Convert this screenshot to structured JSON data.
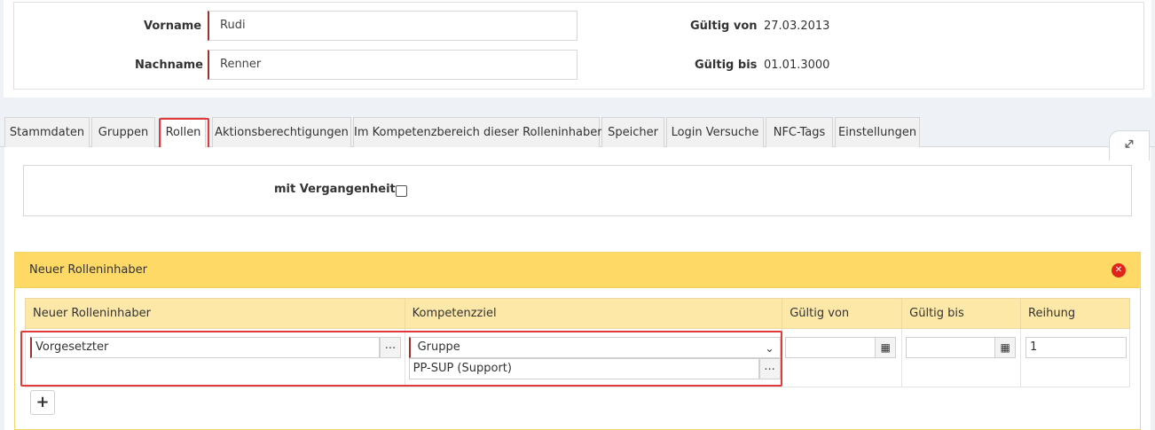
{
  "person": {
    "vorname_label": "Vorname",
    "vorname_value": "Rudi",
    "nachname_label": "Nachname",
    "nachname_value": "Renner",
    "gueltig_von_label": "Gültig von",
    "gueltig_von_value": "27.03.2013",
    "gueltig_bis_label": "Gültig bis",
    "gueltig_bis_value": "01.01.3000"
  },
  "tabs": [
    {
      "label": "Stammdaten"
    },
    {
      "label": "Gruppen"
    },
    {
      "label": "Rollen"
    },
    {
      "label": "Aktionsberechtigungen"
    },
    {
      "label": "Im Kompetenzbereich dieser Rolleninhaber"
    },
    {
      "label": "Speicher"
    },
    {
      "label": "Login Versuche"
    },
    {
      "label": "NFC-Tags"
    },
    {
      "label": "Einstellungen"
    }
  ],
  "active_tab": "Rollen",
  "filter": {
    "mit_vergangenheit_label": "mit Vergangenheit",
    "mit_vergangenheit_checked": false
  },
  "panel": {
    "title": "Neuer Rolleninhaber",
    "columns": [
      "Neuer Rolleninhaber",
      "Kompetenzziel",
      "Gültig von",
      "Gültig bis",
      "Reihung"
    ],
    "row": {
      "rolleninhaber": "Vorgesetzter",
      "kompetenzziel_type": "Gruppe",
      "kompetenzziel_value": "PP-SUP (Support)",
      "gueltig_von": "",
      "gueltig_bis": "",
      "reihung": "1"
    },
    "dots_label": "...",
    "add_label": "+"
  },
  "icons": {
    "calendar": "calendar-icon",
    "chevron": "chevron-down-icon",
    "close": "close-circle-icon",
    "expand": "expand-icon"
  },
  "colors": {
    "panel_header": "#ffd966",
    "table_header": "#fde8a8",
    "highlight": "#e03a3a",
    "required_border": "#a03030"
  }
}
